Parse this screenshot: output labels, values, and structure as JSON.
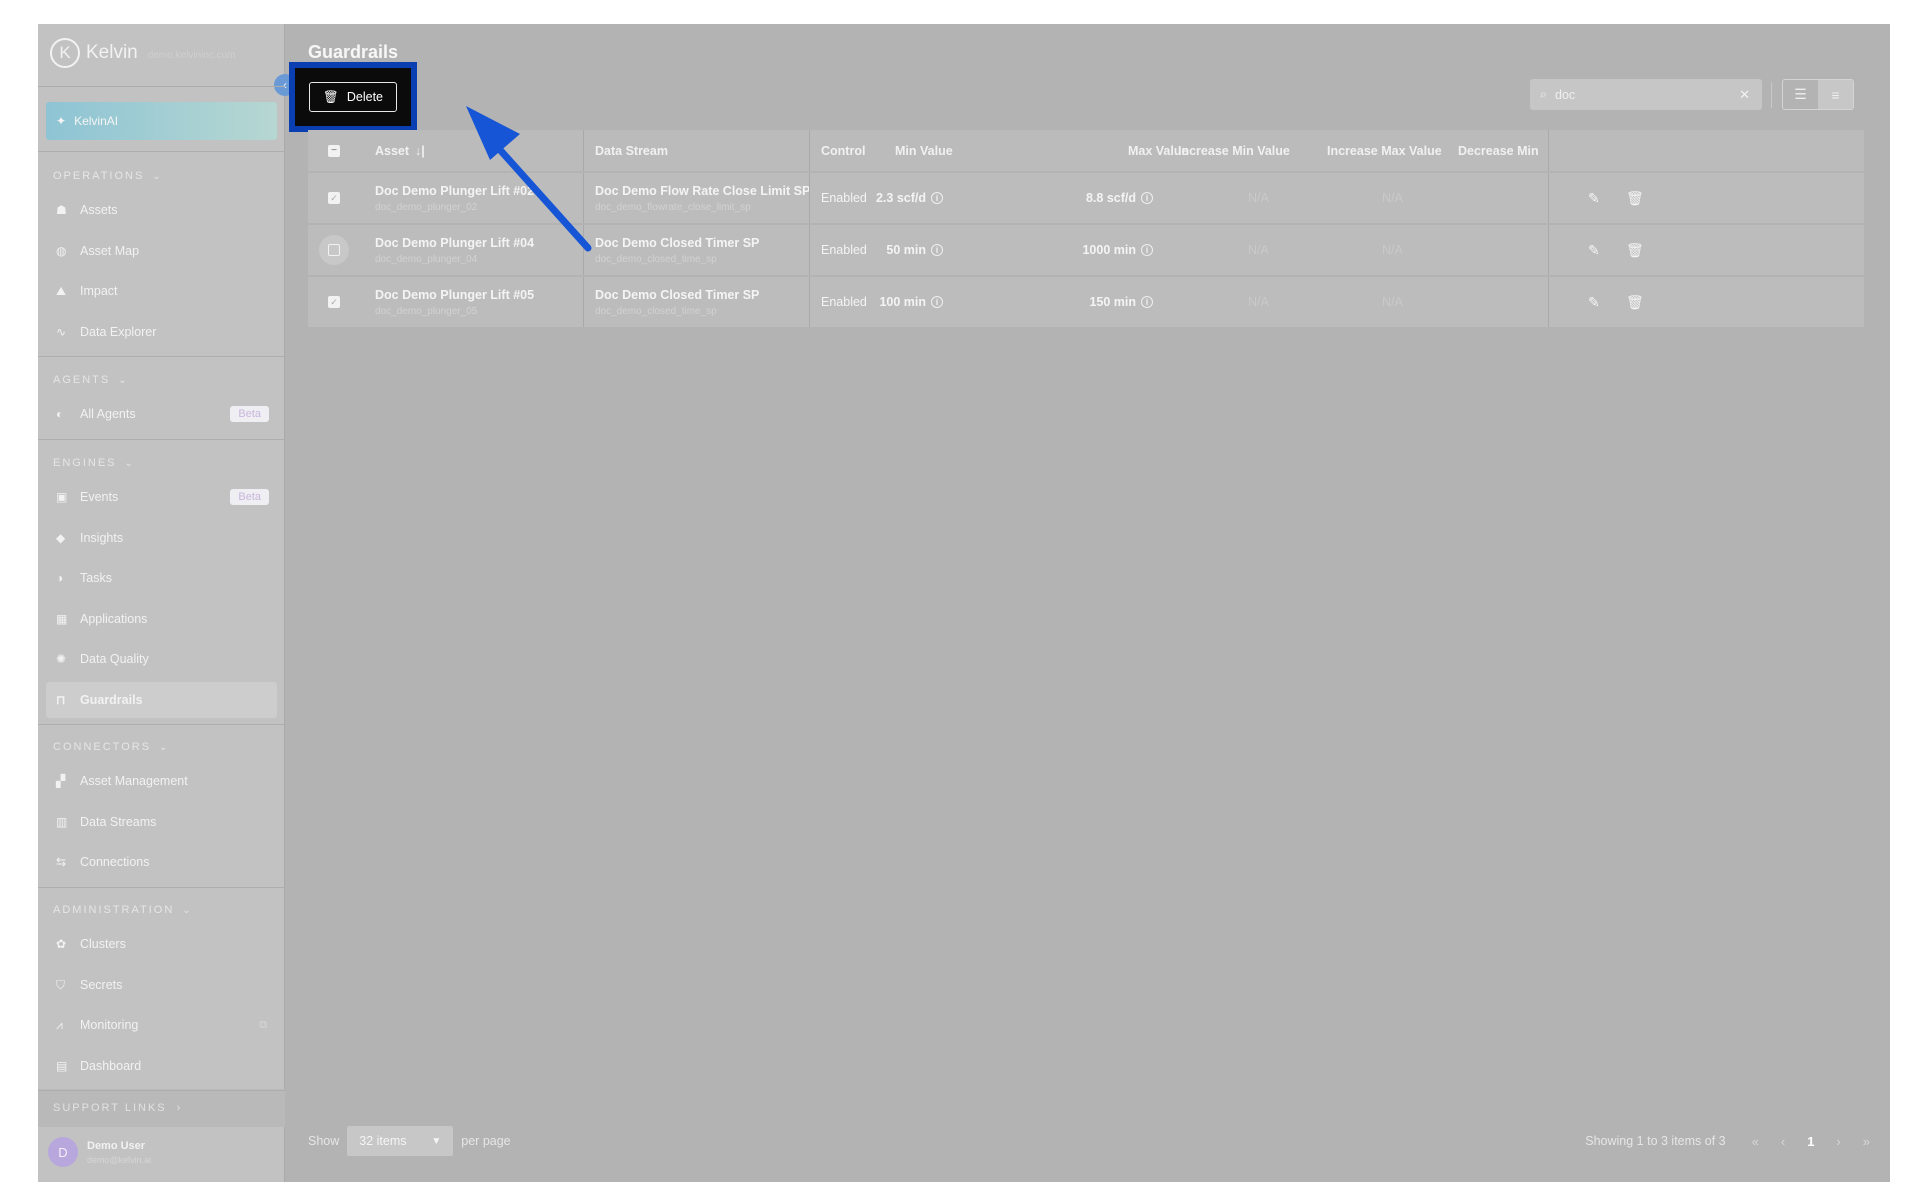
{
  "app": {
    "logo_letter": "K",
    "name": "Kelvin",
    "subtitle": "demo.kelvininc.com"
  },
  "sidebar": {
    "ai_label": "KelvinAI",
    "sections": [
      {
        "title": "OPERATIONS",
        "items": [
          {
            "label": "Assets",
            "icon": "assets-icon"
          },
          {
            "label": "Asset Map",
            "icon": "globe-icon"
          },
          {
            "label": "Impact",
            "icon": "impact-chart-icon"
          },
          {
            "label": "Data Explorer",
            "icon": "pulse-icon"
          }
        ]
      },
      {
        "title": "AGENTS",
        "items": [
          {
            "label": "All Agents",
            "icon": "agent-icon",
            "badge": "Beta"
          }
        ]
      },
      {
        "title": "ENGINES",
        "items": [
          {
            "label": "Events",
            "icon": "events-icon",
            "badge": "Beta"
          },
          {
            "label": "Insights",
            "icon": "tag-icon"
          },
          {
            "label": "Tasks",
            "icon": "tasks-icon"
          },
          {
            "label": "Applications",
            "icon": "apps-grid-icon"
          },
          {
            "label": "Data Quality",
            "icon": "gear-icon"
          },
          {
            "label": "Guardrails",
            "icon": "guardrail-icon"
          }
        ]
      },
      {
        "title": "CONNECTORS",
        "items": [
          {
            "label": "Asset Management",
            "icon": "asset-mgmt-icon"
          },
          {
            "label": "Data Streams",
            "icon": "bar-chart-icon"
          },
          {
            "label": "Connections",
            "icon": "connections-icon"
          }
        ]
      },
      {
        "title": "ADMINISTRATION",
        "items": [
          {
            "label": "Clusters",
            "icon": "clusters-icon"
          },
          {
            "label": "Secrets",
            "icon": "shield-icon"
          },
          {
            "label": "Monitoring",
            "icon": "monitoring-icon"
          },
          {
            "label": "Dashboard",
            "icon": "dashboard-icon"
          }
        ]
      }
    ],
    "support_links": "SUPPORT LINKS",
    "user": {
      "initial": "D",
      "name": "Demo User",
      "email": "demo@kelvin.ai"
    }
  },
  "main": {
    "title": "Guardrails",
    "delete_label": "Delete",
    "search_value": "doc",
    "columns": [
      "Asset",
      "Data Stream",
      "Control",
      "Min Value",
      "Max Value",
      "Increase Min Value",
      "Increase Max Value",
      "Decrease Min"
    ],
    "sort_indicator": "↓|",
    "rows": [
      {
        "checked": true,
        "asset": "Doc Demo Plunger Lift #02",
        "asset_id": "doc_demo_plunger_02",
        "stream": "Doc Demo Flow Rate Close Limit SP",
        "stream_id": "doc_demo_flowrate_close_limit_sp",
        "control": "Enabled",
        "min": "2.3 scf/d",
        "max": "8.8 scf/d",
        "inc_min": "N/A",
        "inc_max": "N/A"
      },
      {
        "checked": false,
        "asset": "Doc Demo Plunger Lift #04",
        "asset_id": "doc_demo_plunger_04",
        "stream": "Doc Demo Closed Timer SP",
        "stream_id": "doc_demo_closed_time_sp",
        "control": "Enabled",
        "min": "50 min",
        "max": "1000 min",
        "inc_min": "N/A",
        "inc_max": "N/A"
      },
      {
        "checked": true,
        "asset": "Doc Demo Plunger Lift #05",
        "asset_id": "doc_demo_plunger_05",
        "stream": "Doc Demo Closed Timer SP",
        "stream_id": "doc_demo_closed_time_sp",
        "control": "Enabled",
        "min": "100 min",
        "max": "150 min",
        "inc_min": "N/A",
        "inc_max": "N/A"
      }
    ],
    "footer": {
      "show": "Show",
      "per_page_value": "32 items",
      "per_page": "per page",
      "showing": "Showing 1 to 3 items of 3",
      "page": "1"
    }
  },
  "colors": {
    "highlight": "#0a3fb2",
    "arrow": "#1656d6"
  }
}
